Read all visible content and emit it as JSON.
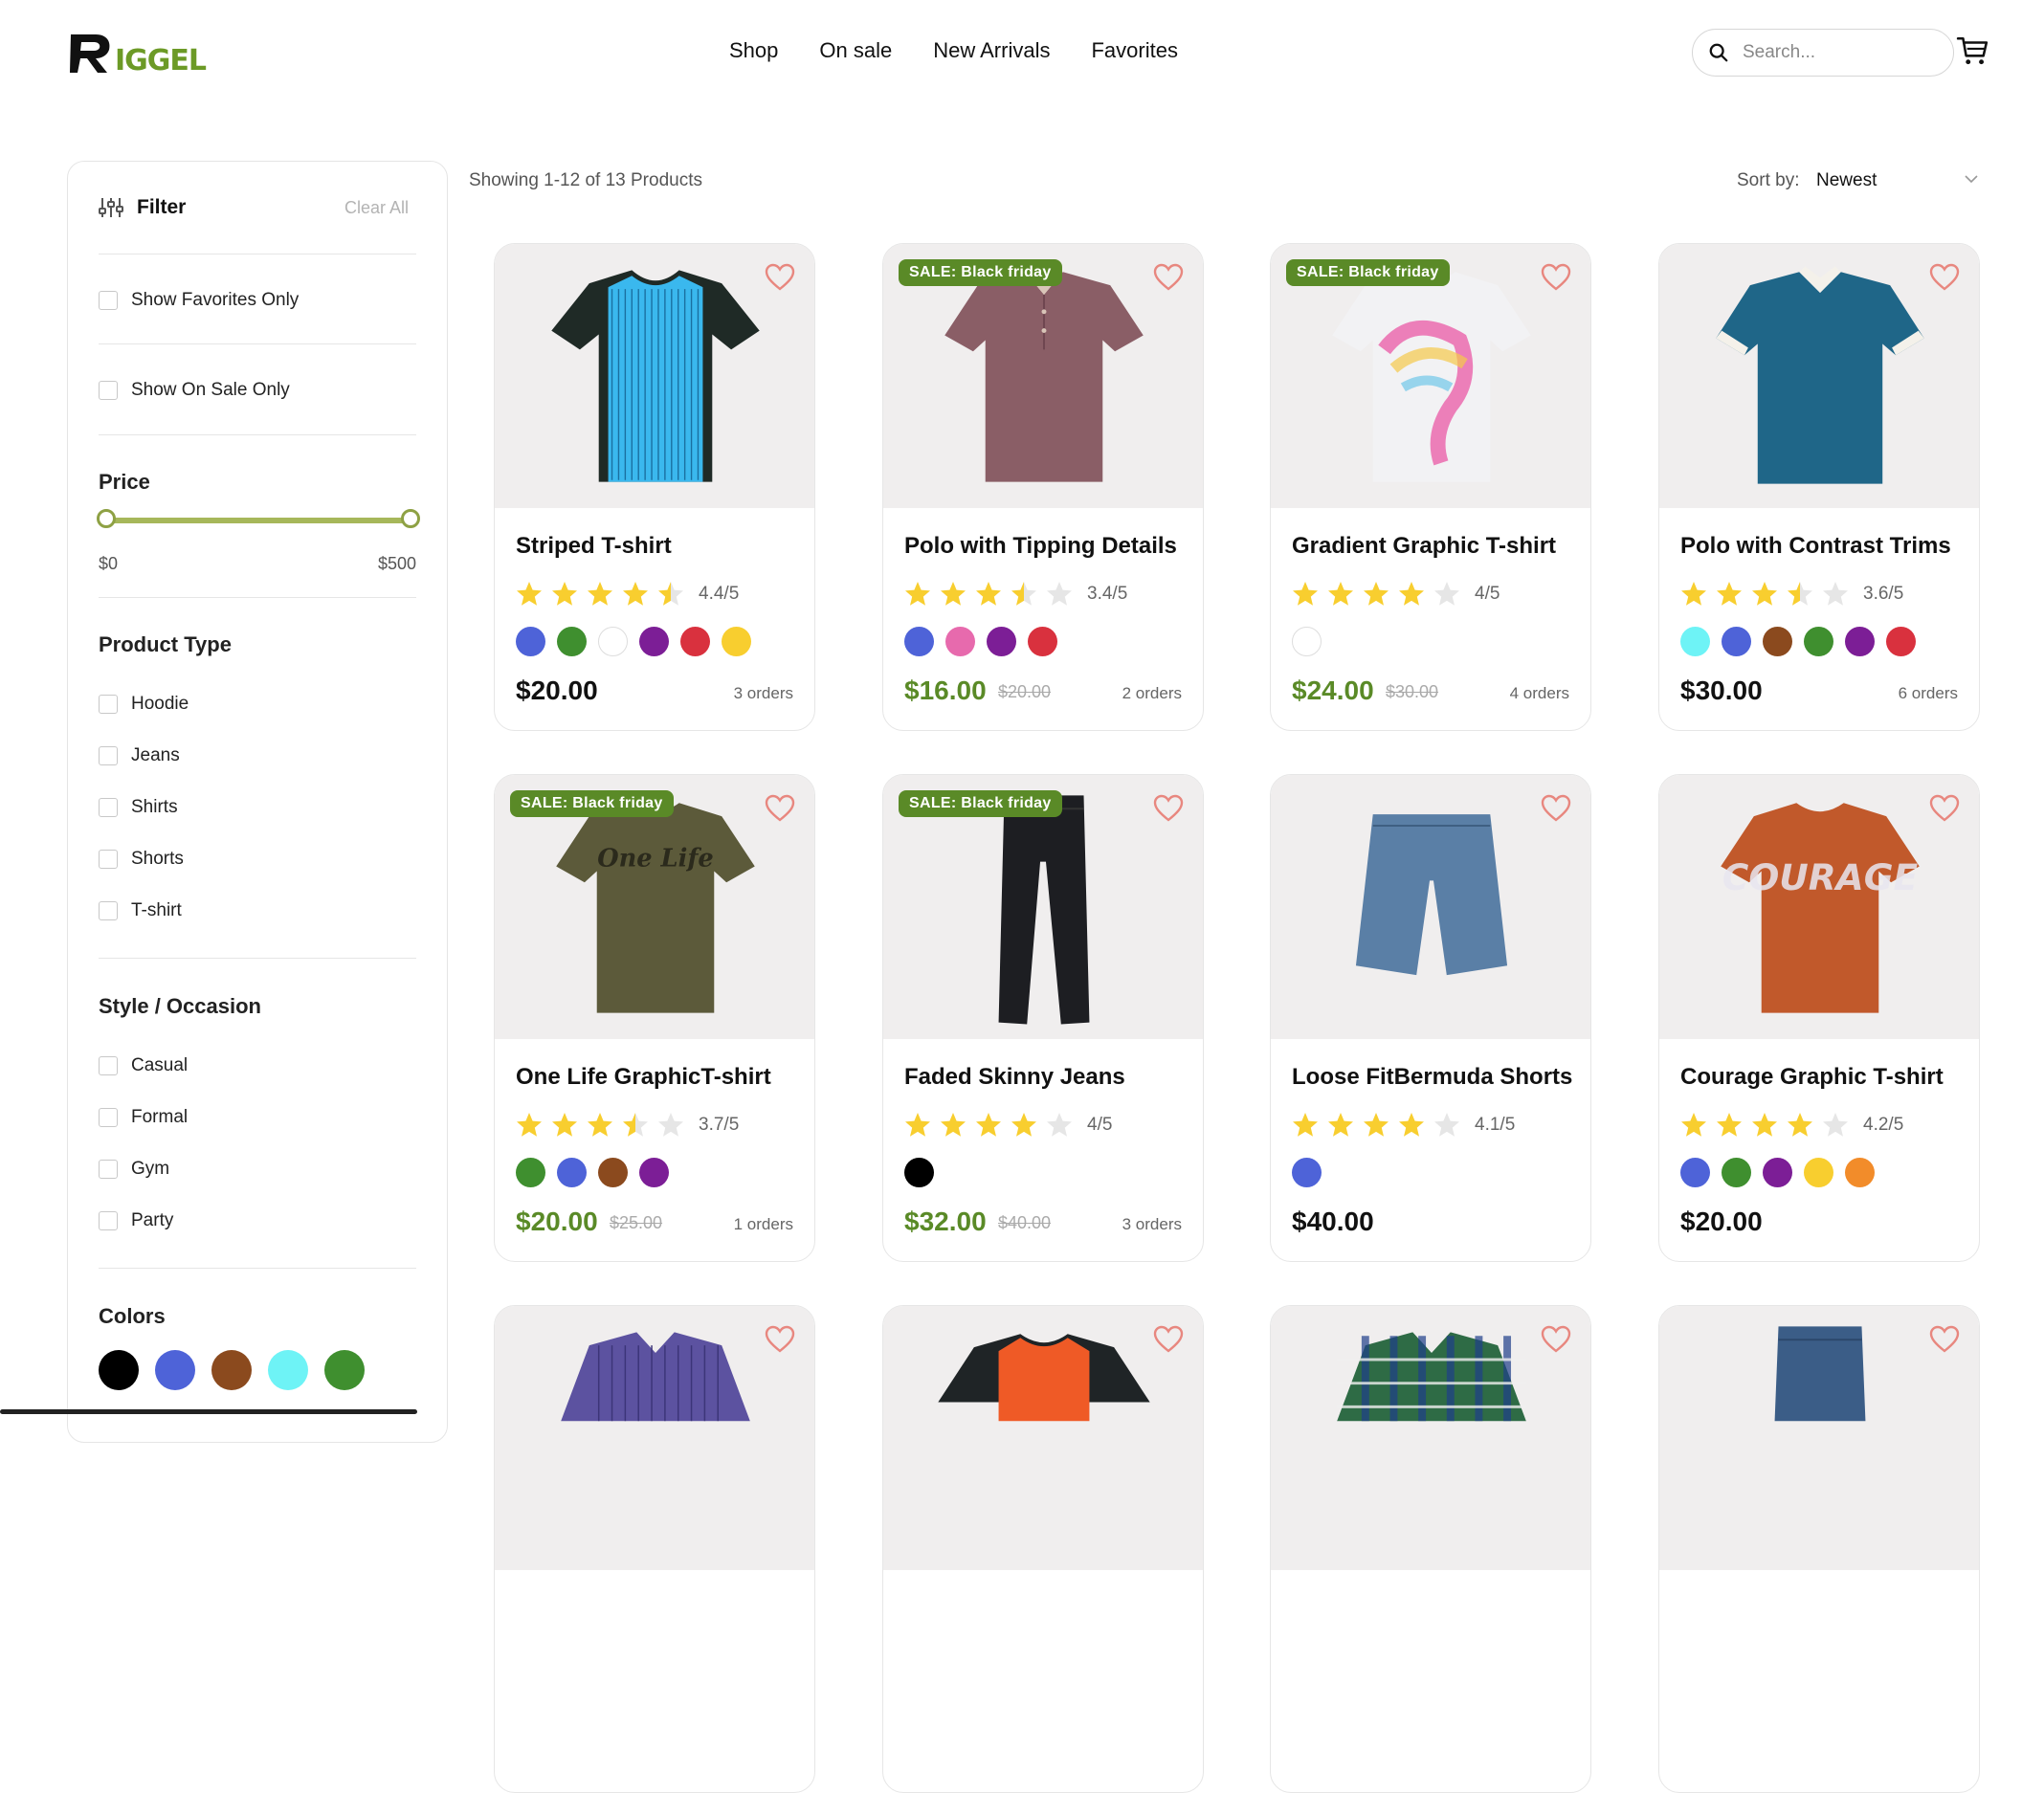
{
  "header": {
    "logo_text": "RIGGEL",
    "nav": [
      "Shop",
      "On sale",
      "New Arrivals",
      "Favorites"
    ],
    "search_placeholder": "Search..."
  },
  "sidebar": {
    "filter_title": "Filter",
    "clear_all": "Clear All",
    "show_favorites": "Show Favorites Only",
    "show_on_sale": "Show On Sale Only",
    "price_title": "Price",
    "price_min": "$0",
    "price_max": "$500",
    "product_type_title": "Product Type",
    "product_types": [
      "Hoodie",
      "Jeans",
      "Shirts",
      "Shorts",
      "T-shirt"
    ],
    "style_title": "Style / Occasion",
    "styles": [
      "Casual",
      "Formal",
      "Gym",
      "Party"
    ],
    "colors_title": "Colors",
    "colors": [
      "#000000",
      "#4e63d8",
      "#8b4a1e",
      "#6ef3f6",
      "#3f8f2f"
    ]
  },
  "main": {
    "results_text": "Showing 1-12 of 13 Products",
    "sort_label": "Sort by:",
    "sort_value": "Newest"
  },
  "products": [
    {
      "name": "Striped T-shirt",
      "rating_text": "4.4/5",
      "rating": 4.4,
      "colors": [
        "#4e63d8",
        "#3f8f2f",
        "#ffffff",
        "#7c1e96",
        "#d9313e",
        "#f8ce2f"
      ],
      "price": "$20.00",
      "old_price": "",
      "orders": "3 orders",
      "sale": ""
    },
    {
      "name": "Polo with Tipping Details",
      "rating_text": "3.4/5",
      "rating": 3.4,
      "colors": [
        "#4e63d8",
        "#e76aad",
        "#7c1e96",
        "#d9313e"
      ],
      "price": "$16.00",
      "old_price": "$20.00",
      "orders": "2 orders",
      "sale": "SALE: Black friday"
    },
    {
      "name": "Gradient Graphic T-shirt",
      "rating_text": "4/5",
      "rating": 4,
      "colors": [
        "#ffffff"
      ],
      "price": "$24.00",
      "old_price": "$30.00",
      "orders": "4 orders",
      "sale": "SALE: Black friday"
    },
    {
      "name": "Polo with Contrast Trims",
      "rating_text": "3.6/5",
      "rating": 3.6,
      "colors": [
        "#6ef3f6",
        "#4e63d8",
        "#8b4a1e",
        "#3f8f2f",
        "#7c1e96",
        "#d9313e"
      ],
      "price": "$30.00",
      "old_price": "",
      "orders": "6 orders",
      "sale": ""
    },
    {
      "name": "One Life GraphicT-shirt",
      "rating_text": "3.7/5",
      "rating": 3.7,
      "colors": [
        "#3f8f2f",
        "#4e63d8",
        "#8b4a1e",
        "#7c1e96"
      ],
      "price": "$20.00",
      "old_price": "$25.00",
      "orders": "1 orders",
      "sale": "SALE: Black friday"
    },
    {
      "name": "Faded Skinny Jeans",
      "rating_text": "4/5",
      "rating": 4,
      "colors": [
        "#000000"
      ],
      "price": "$32.00",
      "old_price": "$40.00",
      "orders": "3 orders",
      "sale": "SALE: Black friday"
    },
    {
      "name": "Loose FitBermuda Shorts",
      "rating_text": "4.1/5",
      "rating": 4.1,
      "colors": [
        "#4e63d8"
      ],
      "price": "$40.00",
      "old_price": "",
      "orders": "",
      "sale": ""
    },
    {
      "name": "Courage Graphic T-shirt",
      "rating_text": "4.2/5",
      "rating": 4.2,
      "colors": [
        "#4e63d8",
        "#3f8f2f",
        "#7c1e96",
        "#f8ce2f",
        "#f28c2a"
      ],
      "price": "$20.00",
      "old_price": "",
      "orders": "",
      "sale": ""
    },
    {
      "name": "",
      "rating_text": "",
      "rating": 0,
      "colors": [],
      "price": "",
      "old_price": "",
      "orders": "",
      "sale": ""
    },
    {
      "name": "",
      "rating_text": "",
      "rating": 0,
      "colors": [],
      "price": "",
      "old_price": "",
      "orders": "",
      "sale": ""
    },
    {
      "name": "",
      "rating_text": "",
      "rating": 0,
      "colors": [],
      "price": "",
      "old_price": "",
      "orders": "",
      "sale": ""
    },
    {
      "name": "",
      "rating_text": "",
      "rating": 0,
      "colors": [],
      "price": "",
      "old_price": "",
      "orders": "",
      "sale": ""
    }
  ],
  "theme": {
    "accent": "#5a8a27",
    "heart": "#e8877f",
    "star": "#f8ce2f",
    "star_empty": "#e6e6e6"
  }
}
